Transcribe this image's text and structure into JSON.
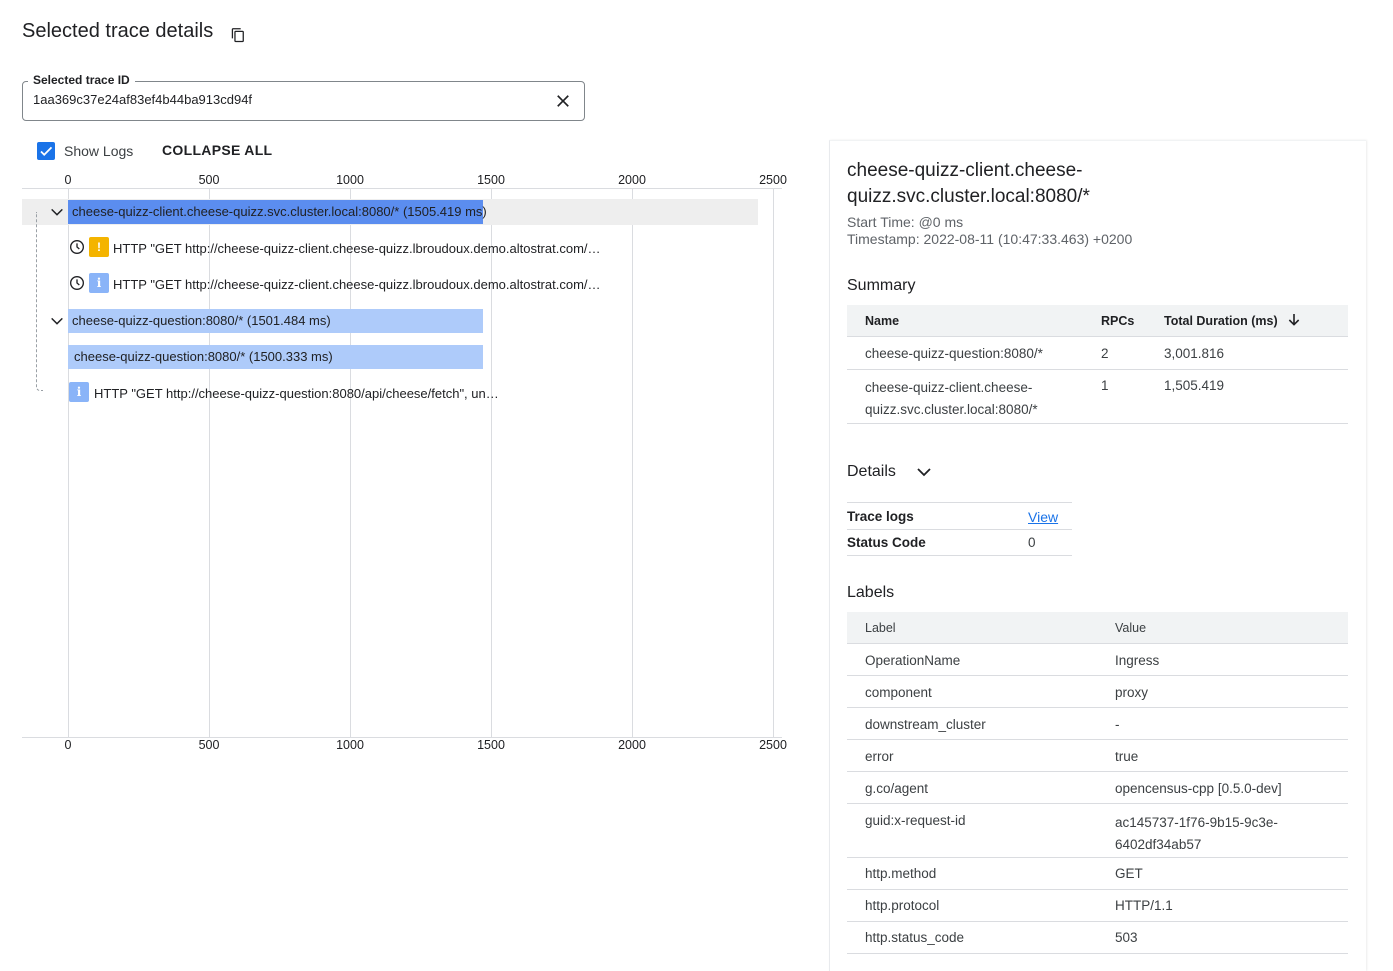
{
  "header": {
    "title": "Selected trace details",
    "copy_icon": "copy-icon"
  },
  "trace_field": {
    "label": "Selected trace ID",
    "value": "1aa369c37e24af83ef4b44ba913cd94f",
    "clear_icon": "close-icon"
  },
  "toolbar": {
    "show_logs_label": "Show Logs",
    "show_logs_checked": true,
    "collapse_all_label": "COLLAPSE ALL"
  },
  "timeline": {
    "ticks": [
      "0",
      "500",
      "1000",
      "1500",
      "2000",
      "2500"
    ],
    "spans": [
      {
        "label": "cheese-quizz-client.cheese-quizz.svc.cluster.local:8080/* (1505.419 ms)"
      },
      {
        "label": "cheese-quizz-question:8080/* (1501.484 ms)"
      },
      {
        "label": "cheese-quizz-question:8080/* (1500.333 ms)"
      }
    ],
    "logs": [
      {
        "text": "HTTP \"GET http://cheese-quizz-client.cheese-quizz.lbroudoux.demo.altostrat.com/…",
        "badge": "!"
      },
      {
        "text": "HTTP \"GET http://cheese-quizz-client.cheese-quizz.lbroudoux.demo.altostrat.com/…",
        "badge": "i"
      },
      {
        "text": "HTTP \"GET http://cheese-quizz-question:8080/api/cheese/fetch\", un…",
        "badge": "i"
      }
    ]
  },
  "details_panel": {
    "span_title": "cheese-quizz-client.cheese-quizz.svc.cluster.local:8080/*",
    "start_time": "Start Time: @0 ms",
    "timestamp": "Timestamp: 2022-08-11 (10:47:33.463) +0200",
    "summary": {
      "heading": "Summary",
      "columns": [
        "Name",
        "RPCs",
        "Total Duration (ms)"
      ],
      "rows": [
        {
          "name": "cheese-quizz-question:8080/*",
          "rpcs": "2",
          "duration": "3,001.816"
        },
        {
          "name": "cheese-quizz-client.cheese-quizz.svc.cluster.local:8080/*",
          "rpcs": "1",
          "duration": "1,505.419"
        }
      ]
    },
    "details": {
      "heading": "Details",
      "trace_logs_label": "Trace logs",
      "trace_logs_link": "View",
      "status_code_label": "Status Code",
      "status_code_value": "0"
    },
    "labels": {
      "heading": "Labels",
      "columns": [
        "Label",
        "Value"
      ],
      "rows": [
        {
          "label": "OperationName",
          "value": "Ingress"
        },
        {
          "label": "component",
          "value": "proxy"
        },
        {
          "label": "downstream_cluster",
          "value": "-"
        },
        {
          "label": "error",
          "value": "true"
        },
        {
          "label": "g.co/agent",
          "value": "opencensus-cpp [0.5.0-dev]"
        },
        {
          "label": "guid:x-request-id",
          "value": "ac145737-1f76-9b15-9c3e-6402df34ab57"
        },
        {
          "label": "http.method",
          "value": "GET"
        },
        {
          "label": "http.protocol",
          "value": "HTTP/1.1"
        },
        {
          "label": "http.status_code",
          "value": "503"
        }
      ]
    }
  }
}
